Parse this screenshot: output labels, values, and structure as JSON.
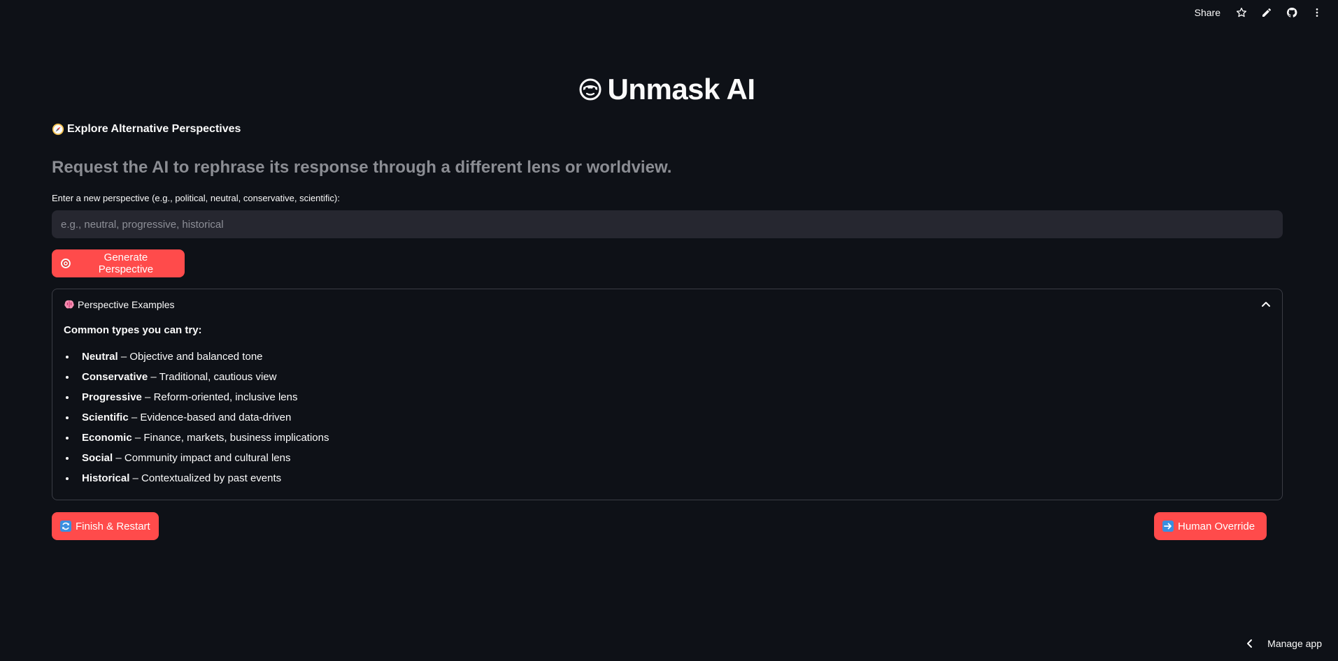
{
  "toolbar": {
    "share_label": "Share",
    "icons": [
      "star-icon",
      "edit-icon",
      "github-icon",
      "more-vertical-icon"
    ]
  },
  "header": {
    "title": "Unmask AI",
    "logo_icon": "mask-face-icon"
  },
  "section": {
    "subheader": "Explore Alternative Perspectives",
    "subheader_icon": "compass-icon",
    "lead": "Request the AI to rephrase its response through a different lens or worldview."
  },
  "perspective_input": {
    "label": "Enter a new perspective (e.g., political, neutral, conservative, scientific):",
    "placeholder": "e.g., neutral, progressive, historical",
    "value": ""
  },
  "generate_button": {
    "label": "Generate Perspective",
    "icon": "target-icon"
  },
  "expander": {
    "title": "Perspective Examples",
    "icon": "brain-icon",
    "expanded": true,
    "heading": "Common types you can try:",
    "items": [
      {
        "name": "Neutral",
        "desc": " – Objective and balanced tone"
      },
      {
        "name": "Conservative",
        "desc": " – Traditional, cautious view"
      },
      {
        "name": "Progressive",
        "desc": " – Reform-oriented, inclusive lens"
      },
      {
        "name": "Scientific",
        "desc": " – Evidence-based and data-driven"
      },
      {
        "name": "Economic",
        "desc": " – Finance, markets, business implications"
      },
      {
        "name": "Social",
        "desc": " – Community impact and cultural lens"
      },
      {
        "name": "Historical",
        "desc": " – Contextualized by past events"
      }
    ]
  },
  "finish_button": {
    "label": "Finish & Restart",
    "icon": "refresh-icon"
  },
  "override_button": {
    "label": "Human Override",
    "icon": "arrow-right-icon"
  },
  "manage_app": {
    "label": "Manage app"
  },
  "colors": {
    "background": "#0e1117",
    "accent": "#ff4b4b",
    "input_bg": "#262730",
    "muted_text": "#8b8d93",
    "border": "#3b3d45"
  }
}
